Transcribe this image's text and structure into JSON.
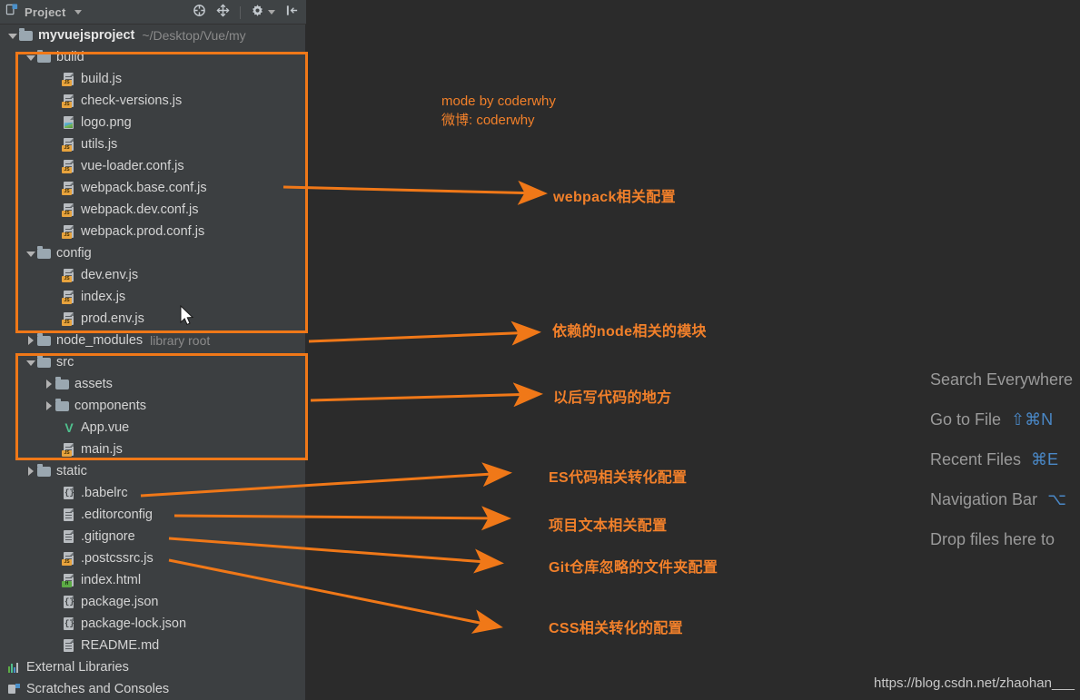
{
  "panel": {
    "title": "Project",
    "icons": [
      {
        "name": "project-view-icon"
      },
      {
        "name": "chevron-down-icon"
      },
      {
        "name": "collapse-all-icon"
      },
      {
        "name": "expand-select-icon"
      },
      {
        "name": "settings-gear-icon"
      },
      {
        "name": "hide-panel-icon"
      }
    ]
  },
  "tree": {
    "root": {
      "label": "myvuejsproject",
      "path": "~/Desktop/Vue/my"
    },
    "items": [
      {
        "label": "build",
        "indent": 1,
        "kind": "folder",
        "twisty": "open"
      },
      {
        "label": "build.js",
        "indent": 3,
        "kind": "js"
      },
      {
        "label": "check-versions.js",
        "indent": 3,
        "kind": "js"
      },
      {
        "label": "logo.png",
        "indent": 3,
        "kind": "png"
      },
      {
        "label": "utils.js",
        "indent": 3,
        "kind": "js"
      },
      {
        "label": "vue-loader.conf.js",
        "indent": 3,
        "kind": "js"
      },
      {
        "label": "webpack.base.conf.js",
        "indent": 3,
        "kind": "js"
      },
      {
        "label": "webpack.dev.conf.js",
        "indent": 3,
        "kind": "js"
      },
      {
        "label": "webpack.prod.conf.js",
        "indent": 3,
        "kind": "js"
      },
      {
        "label": "config",
        "indent": 1,
        "kind": "folder",
        "twisty": "open"
      },
      {
        "label": "dev.env.js",
        "indent": 3,
        "kind": "js"
      },
      {
        "label": "index.js",
        "indent": 3,
        "kind": "js"
      },
      {
        "label": "prod.env.js",
        "indent": 3,
        "kind": "js"
      },
      {
        "label": "node_modules",
        "indent": 1,
        "kind": "folder",
        "twisty": "closed",
        "sublabel": "library root"
      },
      {
        "label": "src",
        "indent": 1,
        "kind": "folder",
        "twisty": "open"
      },
      {
        "label": "assets",
        "indent": 2,
        "kind": "folder",
        "twisty": "closed"
      },
      {
        "label": "components",
        "indent": 2,
        "kind": "folder",
        "twisty": "closed"
      },
      {
        "label": "App.vue",
        "indent": 3,
        "kind": "vue"
      },
      {
        "label": "main.js",
        "indent": 3,
        "kind": "js"
      },
      {
        "label": "static",
        "indent": 1,
        "kind": "folder",
        "twisty": "closed"
      },
      {
        "label": ".babelrc",
        "indent": 3,
        "kind": "json"
      },
      {
        "label": ".editorconfig",
        "indent": 3,
        "kind": "doc"
      },
      {
        "label": ".gitignore",
        "indent": 3,
        "kind": "doc"
      },
      {
        "label": ".postcssrc.js",
        "indent": 3,
        "kind": "js"
      },
      {
        "label": "index.html",
        "indent": 3,
        "kind": "html"
      },
      {
        "label": "package.json",
        "indent": 3,
        "kind": "json"
      },
      {
        "label": "package-lock.json",
        "indent": 3,
        "kind": "json"
      },
      {
        "label": "README.md",
        "indent": 3,
        "kind": "doc"
      },
      {
        "label": "External Libraries",
        "indent": 0,
        "kind": "libs"
      },
      {
        "label": "Scratches and Consoles",
        "indent": 0,
        "kind": "scratches"
      }
    ]
  },
  "annotations": {
    "credit_line1": "mode by coderwhy",
    "credit_line2": "微博: coderwhy",
    "labels": [
      {
        "text": "webpack相关配置"
      },
      {
        "text": "依赖的node相关的模块"
      },
      {
        "text": "以后写代码的地方"
      },
      {
        "text": "ES代码相关转化配置"
      },
      {
        "text": "项目文本相关配置"
      },
      {
        "text": "Git仓库忽略的文件夹配置"
      },
      {
        "text": "CSS相关转化的配置"
      }
    ],
    "accent_color": "#f07818"
  },
  "editor_hints": [
    {
      "label": "Search Everywhere",
      "shortcut": ""
    },
    {
      "label": "Go to File",
      "shortcut": "⇧⌘N"
    },
    {
      "label": "Recent Files",
      "shortcut": "⌘E"
    },
    {
      "label": "Navigation Bar",
      "shortcut": "⌥"
    },
    {
      "label": "Drop files here to",
      "shortcut": ""
    }
  ],
  "watermark": "https://blog.csdn.net/zhaohan___"
}
